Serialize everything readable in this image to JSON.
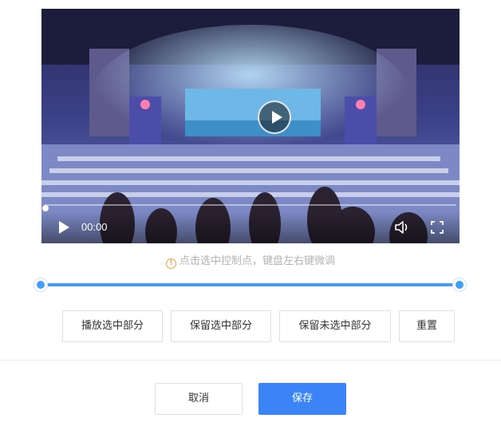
{
  "video": {
    "current_time": "00:00",
    "progress": 0
  },
  "hint": {
    "icon": "info-circle-icon",
    "text": "点击选中控制点，键盘左右键微调"
  },
  "range": {
    "start": 0,
    "end": 1
  },
  "actions": {
    "play_selected": "播放选中部分",
    "keep_selected": "保留选中部分",
    "keep_unselected": "保留未选中部分",
    "reset": "重置"
  },
  "footer": {
    "cancel": "取消",
    "save": "保存"
  },
  "colors": {
    "accent": "#409eff",
    "primary_button": "#3a84f7",
    "warning": "#e6a23c"
  }
}
